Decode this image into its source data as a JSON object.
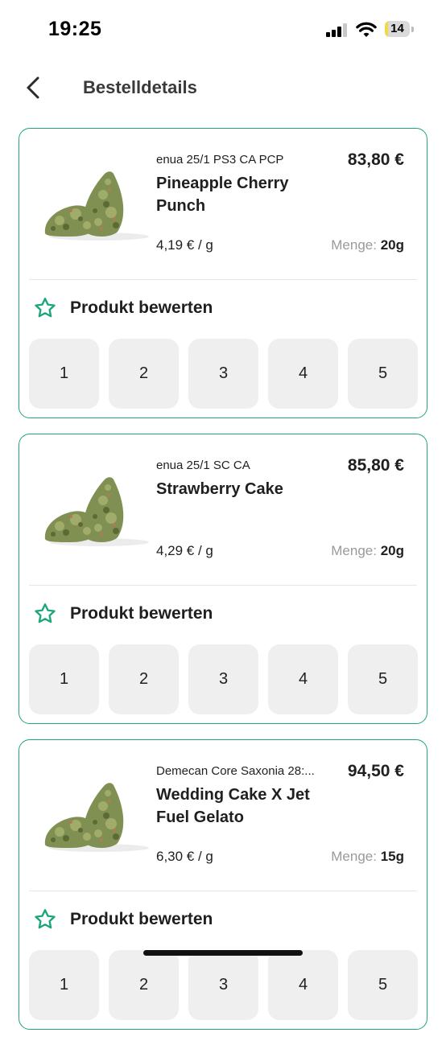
{
  "status_bar": {
    "time": "19:25",
    "battery": "14",
    "battery_level": 0.14,
    "battery_color": "#f5d64a"
  },
  "header": {
    "title": "Bestelldetails"
  },
  "colors": {
    "accent": "#1ea57b",
    "rating_button_bg": "#efefef",
    "muted_text": "#9a9a9a"
  },
  "products": [
    {
      "variant": "enua 25/1 PS3 CA PCP",
      "name": "Pineapple Cherry Punch",
      "price": "83,80 €",
      "unit_price": "4,19 € / g",
      "quantity_label": "Menge:",
      "quantity": "20g",
      "rate_label": "Produkt bewerten",
      "ratings": [
        "1",
        "2",
        "3",
        "4",
        "5"
      ]
    },
    {
      "variant": "enua 25/1 SC CA",
      "name": "Strawberry Cake",
      "price": "85,80 €",
      "unit_price": "4,29 € / g",
      "quantity_label": "Menge:",
      "quantity": "20g",
      "rate_label": "Produkt bewerten",
      "ratings": [
        "1",
        "2",
        "3",
        "4",
        "5"
      ]
    },
    {
      "variant": "Demecan Core Saxonia 28:...",
      "name": "Wedding Cake X Jet Fuel Gelato",
      "price": "94,50 €",
      "unit_price": "6,30 € / g",
      "quantity_label": "Menge:",
      "quantity": "15g",
      "rate_label": "Produkt bewerten",
      "ratings": [
        "1",
        "2",
        "3",
        "4",
        "5"
      ]
    }
  ]
}
